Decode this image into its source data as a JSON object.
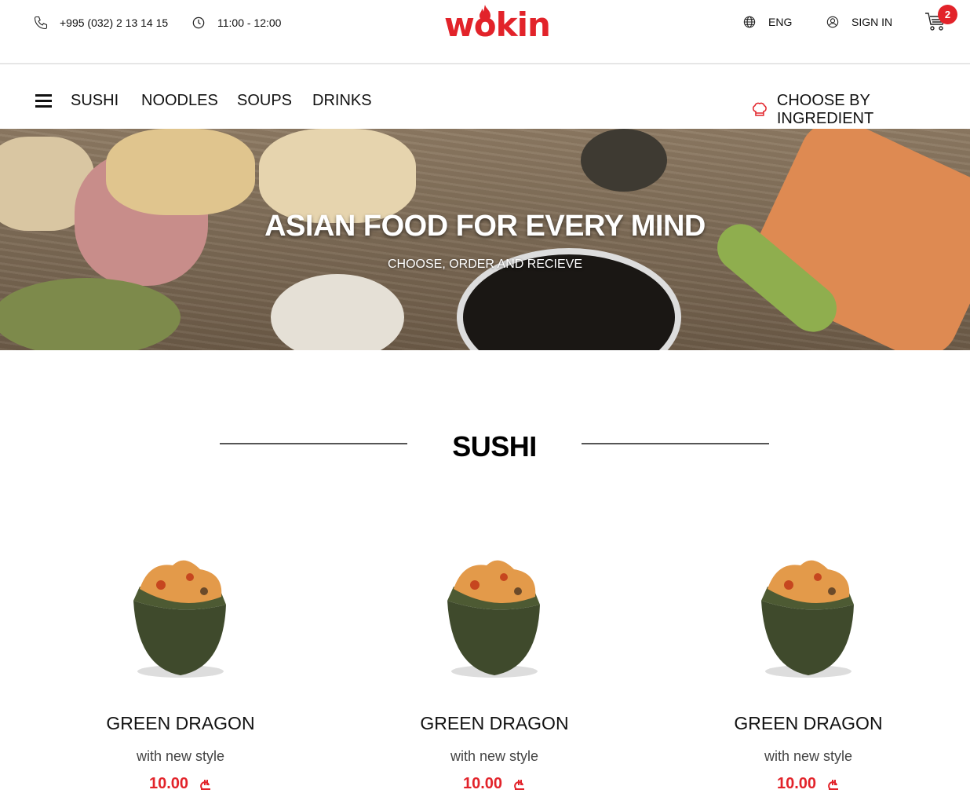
{
  "topbar": {
    "phone": "+995 (032) 2 13 14 15",
    "hours": "11:00 - 12:00",
    "logo": "wokin",
    "language": "ENG",
    "sign_in": "SIGN IN",
    "cart_count": "2",
    "icons": {
      "phone": "phone-icon",
      "clock": "clock-icon",
      "globe": "globe-icon",
      "user": "user-icon",
      "cart": "cart-icon"
    }
  },
  "nav": {
    "items": [
      "SUSHI",
      "NOODLES",
      "SOUPS",
      "DRINKS"
    ],
    "ingredient_label": "CHOOSE BY INGREDIENT"
  },
  "hero": {
    "title": "ASIAN FOOD FOR EVERY MIND",
    "subtitle": "CHOOSE, ORDER AND RECIEVE"
  },
  "section": {
    "title": "SUSHI"
  },
  "products": [
    {
      "name": "GREEN DRAGON",
      "desc": "with new style",
      "price": "10.00"
    },
    {
      "name": "GREEN DRAGON",
      "desc": "with new style",
      "price": "10.00"
    },
    {
      "name": "GREEN DRAGON",
      "desc": "with new style",
      "price": "10.00"
    }
  ],
  "colors": {
    "accent": "#e2232a"
  }
}
